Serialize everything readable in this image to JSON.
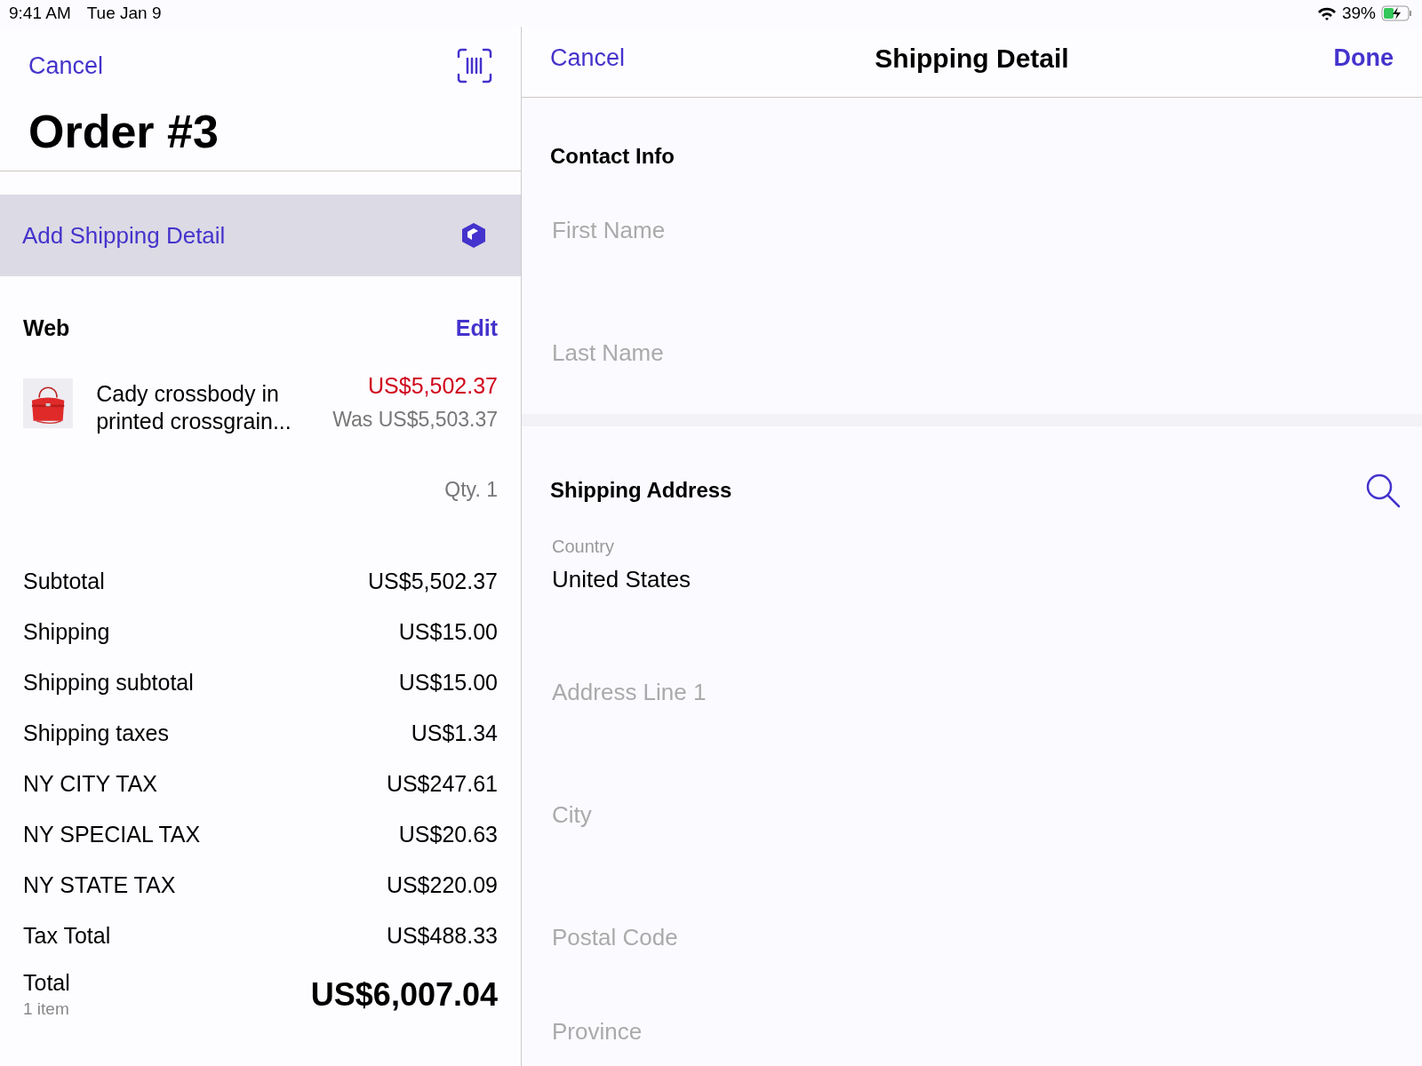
{
  "status_bar": {
    "time": "9:41 AM",
    "date": "Tue Jan 9",
    "battery": "39%"
  },
  "order": {
    "cancel": "Cancel",
    "title": "Order #3",
    "add_shipping": "Add Shipping Detail",
    "section": "Web",
    "edit": "Edit",
    "item": {
      "name": "Cady crossbody in printed crossgrain...",
      "price": "US$5,502.37",
      "was": "Was US$5,503.37",
      "qty": "Qty. 1"
    },
    "summary": [
      {
        "label": "Subtotal",
        "value": "US$5,502.37"
      },
      {
        "label": "Shipping",
        "value": "US$15.00"
      },
      {
        "label": "Shipping subtotal",
        "value": "US$15.00"
      },
      {
        "label": "Shipping taxes",
        "value": "US$1.34"
      },
      {
        "label": "NY CITY TAX",
        "value": "US$247.61"
      },
      {
        "label": "NY SPECIAL TAX",
        "value": "US$20.63"
      },
      {
        "label": "NY STATE TAX",
        "value": "US$220.09"
      },
      {
        "label": "Tax Total",
        "value": "US$488.33"
      }
    ],
    "total": {
      "label": "Total",
      "count": "1 item",
      "value": "US$6,007.04"
    }
  },
  "shipping_detail": {
    "cancel": "Cancel",
    "title": "Shipping Detail",
    "done": "Done",
    "sections": [
      {
        "title": "Contact Info",
        "searchable": false,
        "fields": [
          {
            "placeholder": "First Name"
          },
          {
            "placeholder": "Last Name"
          }
        ]
      },
      {
        "title": "Shipping Address",
        "searchable": true,
        "fields": [
          {
            "label": "Country",
            "value": "United States"
          },
          {
            "placeholder": "Address Line 1"
          },
          {
            "placeholder": "City"
          },
          {
            "placeholder": "Postal Code"
          },
          {
            "placeholder": "Province"
          }
        ]
      }
    ]
  }
}
